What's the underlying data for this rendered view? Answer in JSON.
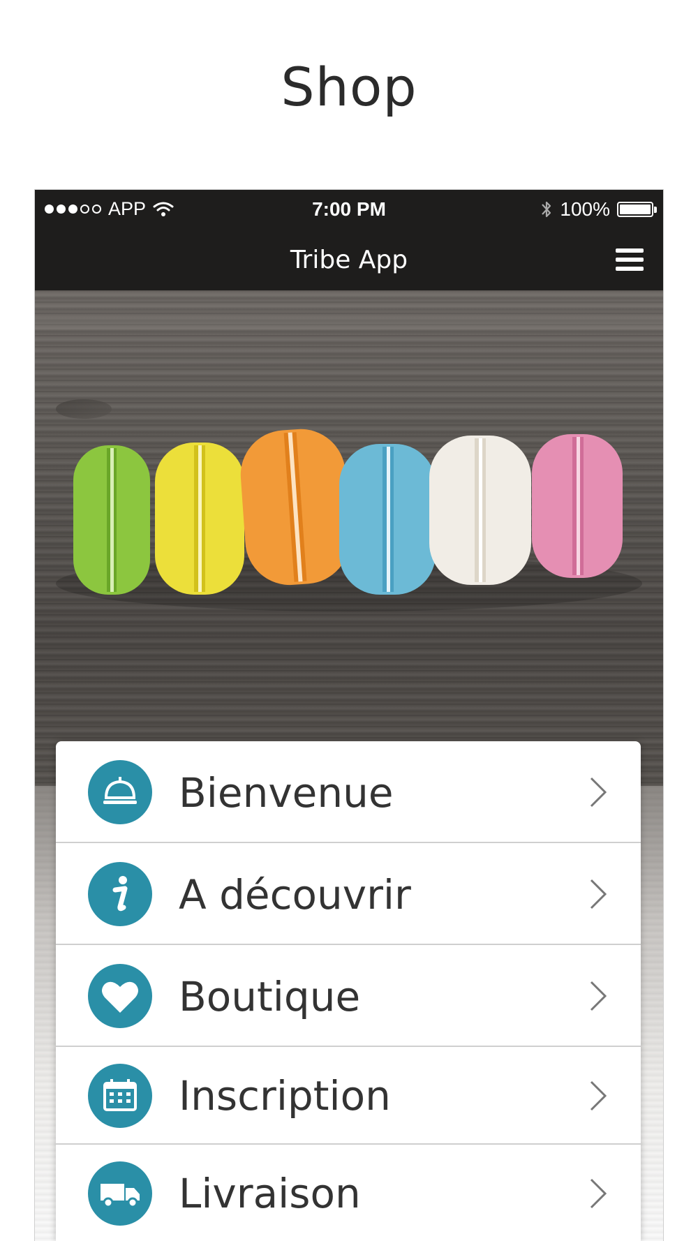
{
  "page": {
    "heading": "Shop"
  },
  "status_bar": {
    "carrier": "APP",
    "time": "7:00 PM",
    "battery": "100%",
    "signal_bars_filled": 3,
    "signal_bars_total": 5
  },
  "nav_bar": {
    "title": "Tribe App",
    "menu_icon": "hamburger-menu-icon"
  },
  "hero": {
    "description_icon": "macarons-photo",
    "macaron_colors": [
      "#8cc63f",
      "#ecdf3a",
      "#f29a38",
      "#6cbad6",
      "#f1ede6",
      "#e58fb3"
    ]
  },
  "menu": {
    "accent_color": "#2a8fa7",
    "items": [
      {
        "label": "Bienvenue",
        "icon": "service-bell-icon"
      },
      {
        "label": "A découvrir",
        "icon": "info-icon"
      },
      {
        "label": "Boutique",
        "icon": "heart-icon"
      },
      {
        "label": "Inscription",
        "icon": "calendar-icon"
      },
      {
        "label": "Livraison",
        "icon": "delivery-truck-icon"
      }
    ]
  }
}
